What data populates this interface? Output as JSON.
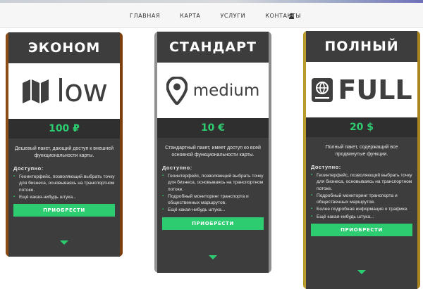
{
  "nav": {
    "links": [
      "ГЛАВНАЯ",
      "КАРТА",
      "УСЛУГИ",
      "КОНТАКТЫ"
    ],
    "user_icon": "user-icon"
  },
  "plans": [
    {
      "title": "ЭКОНОМ",
      "logo_text": "low",
      "logo_icon": "map-icon",
      "price": "100 ₽",
      "description": "Дешевый пакет, дающий доступ к внешней функциональности карты.",
      "available_label": "Доступно:",
      "features": [
        "Геоинтерфейс, позволяющий выбрать точку для бизнеса, основываясь на транспортном потоке.",
        "Ещё какая-нибудь штука..."
      ],
      "button": "ПРИОБРЕСТИ",
      "frame": "bronze"
    },
    {
      "title": "СТАНДАРТ",
      "logo_text": "medium",
      "logo_icon": "location-pin-icon",
      "price": "10 €",
      "description": "Стандартный пакет, имеет доступ ко всей основной функциональности карты.",
      "available_label": "Доступно:",
      "features": [
        "Геоинтерфейс, позволяющий выбрать точку для бизнеса, основываясь на транспортном потоке.",
        "Подробный мониторинг транспорта и общественных маршрутов.",
        "Ещё какая-нибудь штука..."
      ],
      "button": "ПРИОБРЕСТИ",
      "frame": "silver"
    },
    {
      "title": "ПОЛНЫЙ",
      "logo_text": "FULL",
      "logo_icon": "globe-book-icon",
      "price": "20 $",
      "description": "Полный пакет, содержащий все продвинутые функции.",
      "available_label": "Доступно:",
      "features": [
        "Геоинтерфейс, позволяющий выбрать точку для бизнеса, основываясь на транспортном потоке.",
        "Подробный мониторинг транспорта и общественных маршрутов.",
        "Более подробная информация о трафике.",
        "Ещё какая-нибудь штука..."
      ],
      "button": "ПРИОБРЕСТИ",
      "frame": "gold"
    }
  ],
  "colors": {
    "accent": "#2ecc71",
    "card_bg": "#3d3d3d",
    "price_band": "#2f2f2f"
  }
}
